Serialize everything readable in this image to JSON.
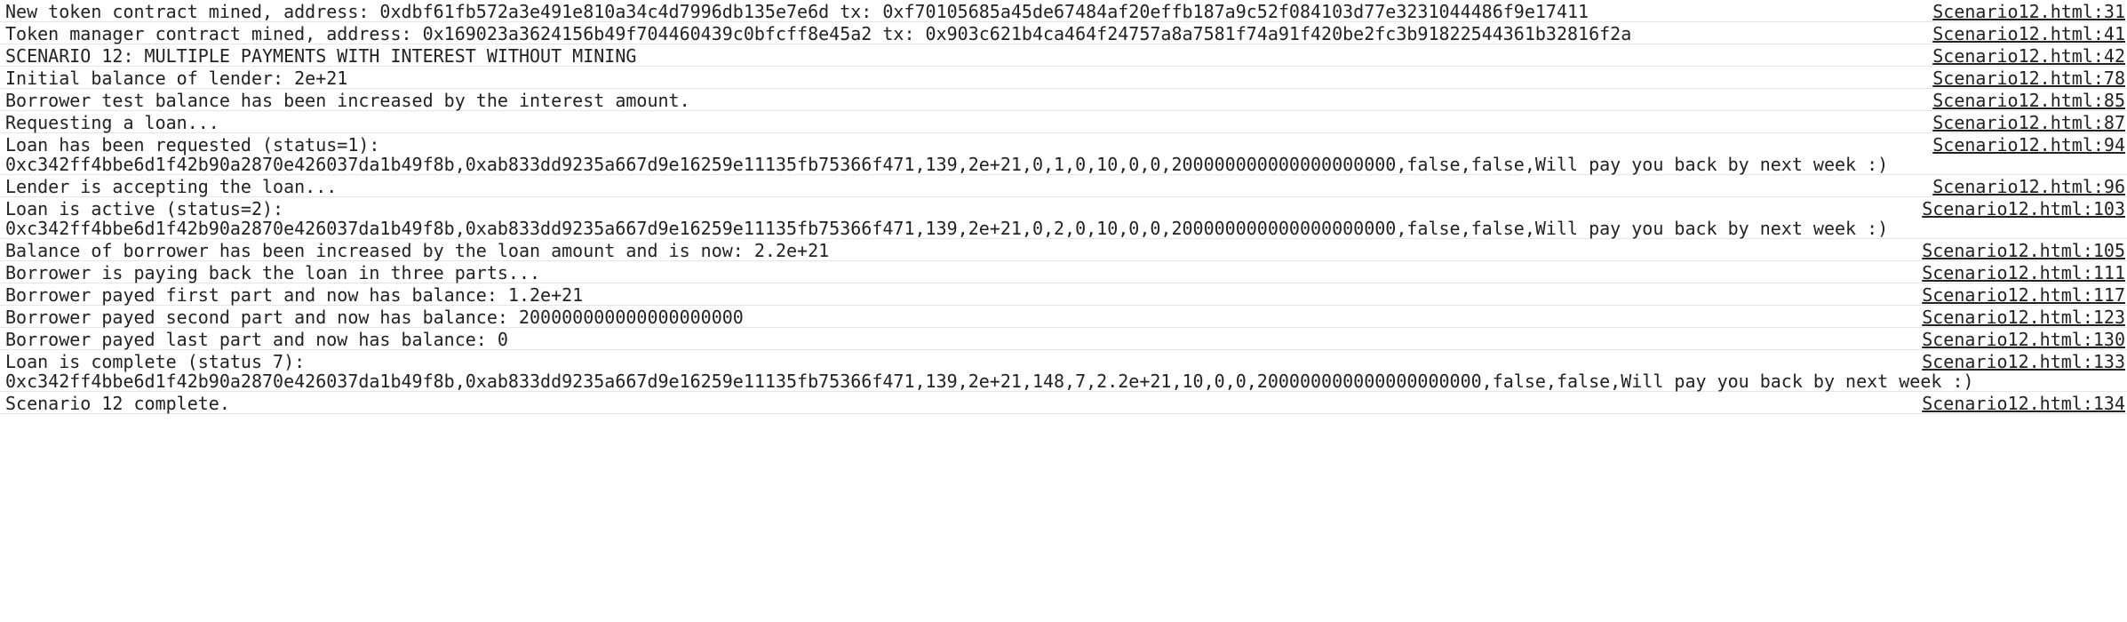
{
  "console": {
    "entries": [
      {
        "message": "New token contract mined, address: 0xdbf61fb572a3e491e810a34c4d7996db135e7e6d tx: 0xf70105685a45de67484af20effb187a9c52f084103d77e3231044486f9e17411",
        "source": "Scenario12.html:31"
      },
      {
        "message": "Token manager contract mined, address: 0x169023a3624156b49f704460439c0bfcff8e45a2 tx: 0x903c621b4ca464f24757a8a7581f74a91f420be2fc3b91822544361b32816f2a",
        "source": "Scenario12.html:41"
      },
      {
        "message": "SCENARIO 12: MULTIPLE PAYMENTS WITH INTEREST WITHOUT MINING",
        "source": "Scenario12.html:42"
      },
      {
        "message": "Initial balance of lender: 2e+21",
        "source": "Scenario12.html:78"
      },
      {
        "message": "Borrower test balance has been increased by the interest amount.",
        "source": "Scenario12.html:85"
      },
      {
        "message": "Requesting a loan...",
        "source": "Scenario12.html:87"
      },
      {
        "message": "Loan has been requested (status=1):",
        "detail": "0xc342ff4bbe6d1f42b90a2870e426037da1b49f8b,0xab833dd9235a667d9e16259e11135fb75366f471,139,2e+21,0,1,0,10,0,0,200000000000000000000,false,false,Will pay you back by next week :)",
        "source": "Scenario12.html:94"
      },
      {
        "message": "Lender is accepting the loan...",
        "source": "Scenario12.html:96"
      },
      {
        "message": "Loan is active (status=2):",
        "detail": "0xc342ff4bbe6d1f42b90a2870e426037da1b49f8b,0xab833dd9235a667d9e16259e11135fb75366f471,139,2e+21,0,2,0,10,0,0,200000000000000000000,false,false,Will pay you back by next week :)",
        "source": "Scenario12.html:103"
      },
      {
        "message": "Balance of borrower has been increased by the loan amount and is now: 2.2e+21",
        "source": "Scenario12.html:105"
      },
      {
        "message": "Borrower is paying back the loan in three parts...",
        "source": "Scenario12.html:111"
      },
      {
        "message": "Borrower payed first part and now has balance: 1.2e+21",
        "source": "Scenario12.html:117"
      },
      {
        "message": "Borrower payed second part and now has balance: 200000000000000000000",
        "source": "Scenario12.html:123"
      },
      {
        "message": "Borrower payed last part and now has balance: 0",
        "source": "Scenario12.html:130"
      },
      {
        "message": "Loan is complete (status 7):",
        "detail": "0xc342ff4bbe6d1f42b90a2870e426037da1b49f8b,0xab833dd9235a667d9e16259e11135fb75366f471,139,2e+21,148,7,2.2e+21,10,0,0,200000000000000000000,false,false,Will pay you back by next week :)",
        "source": "Scenario12.html:133"
      },
      {
        "message": "Scenario 12 complete.",
        "source": "Scenario12.html:134"
      }
    ]
  }
}
